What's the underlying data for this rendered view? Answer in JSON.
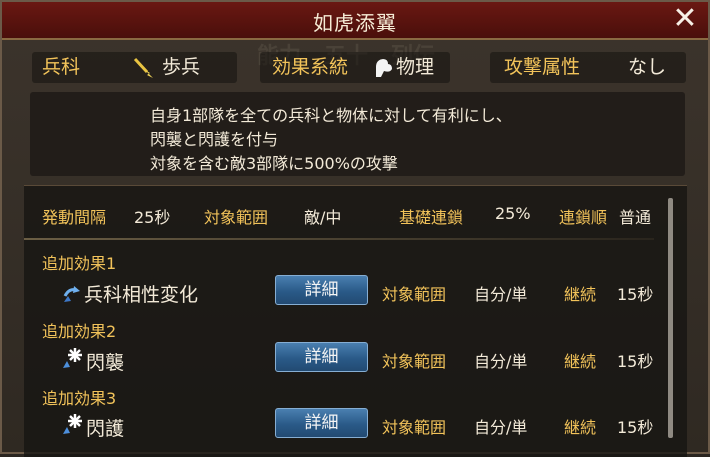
{
  "title": "如虎添翼",
  "header": {
    "troop_label": "兵科",
    "troop_value": "歩兵",
    "effect_system_label": "効果系統",
    "effect_system_value": "物理",
    "attack_attr_label": "攻撃属性",
    "attack_attr_value": "なし"
  },
  "description": [
    "自身1部隊を全ての兵科と物体に対して有利にし、",
    "閃襲と閃護を付与",
    "対象を含む敵3部隊に500%の攻撃"
  ],
  "stats": {
    "interval_label": "発動間隔",
    "interval_value": "25秒",
    "target_label": "対象範囲",
    "target_value": "敵/中",
    "chain_label": "基礎連鎖",
    "chain_value": "25%",
    "order_label": "連鎖順",
    "order_value": "普通"
  },
  "effects": [
    {
      "label": "追加効果1",
      "name": "兵科相性変化",
      "button": "詳細",
      "range_label": "対象範囲",
      "range_value": "自分/単",
      "dur_label": "継続",
      "dur_value": "15秒",
      "icon": "arrow-up-icon"
    },
    {
      "label": "追加効果2",
      "name": "閃襲",
      "button": "詳細",
      "range_label": "対象範囲",
      "range_value": "自分/単",
      "dur_label": "継続",
      "dur_value": "15秒",
      "icon": "sparkle-up-icon"
    },
    {
      "label": "追加効果3",
      "name": "閃護",
      "button": "詳細",
      "range_label": "対象範囲",
      "range_value": "自分/単",
      "dur_label": "継続",
      "dur_value": "15秒",
      "icon": "sparkle-up-icon"
    }
  ],
  "colors": {
    "accent_gold": "#f2c35a",
    "title_red": "#6a1812",
    "button_blue": "#2a5a88"
  }
}
